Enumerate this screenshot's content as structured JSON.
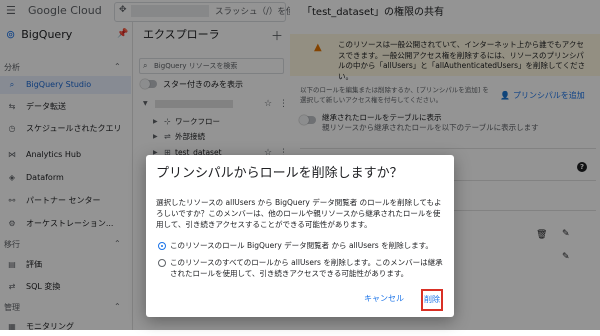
{
  "topbar": {
    "logo": "Google Cloud",
    "project_selector_text": "スラッシュ（/）を使用"
  },
  "sidebar": {
    "product": "BigQuery",
    "sections": [
      {
        "label": "分析"
      },
      {
        "label": "移行"
      },
      {
        "label": "管理"
      }
    ],
    "items": [
      {
        "label": "BigQuery Studio",
        "icon": "search-icon"
      },
      {
        "label": "データ転送",
        "icon": "transfer-icon"
      },
      {
        "label": "スケジュールされたクエリ",
        "icon": "clock-icon"
      },
      {
        "label": "Analytics Hub",
        "icon": "hub-icon"
      },
      {
        "label": "Dataform",
        "icon": "dataform-icon"
      },
      {
        "label": "パートナー センター",
        "icon": "partner-icon"
      },
      {
        "label": "オーケストレーション...",
        "icon": "orchestration-icon"
      },
      {
        "label": "評価",
        "icon": "assessment-icon"
      },
      {
        "label": "SQL 変換",
        "icon": "translate-icon"
      },
      {
        "label": "モニタリング",
        "icon": "monitoring-icon"
      }
    ]
  },
  "explorer": {
    "title": "エクスプローラ",
    "search_placeholder": "BigQuery リソースを検索",
    "starred_only_label": "スター付きのみを表示",
    "tree": [
      {
        "label": "ワークフロー"
      },
      {
        "label": "外部接続"
      },
      {
        "label": "test_dataset"
      }
    ]
  },
  "panel": {
    "title": "「test_dataset」の権限の共有",
    "warning_text": "このリソースは一般公開されていて、インターネット上から誰でもアクセスできます。一般公開アクセス権を削除するには、リソースのプリンシパルの中から「allUsers」と「allAuthenticatedUsers」を削除してください。",
    "info_text": "以下のロールを編集または削除するか、[プリンシパルを追加] を選択して新しいアクセス権を付与してください。",
    "add_principal_label": "プリンシパルを追加",
    "inherited_roles_label": "継承されたロールをテーブルに表示",
    "inherited_roles_desc": "親リソースから継承されたロールを以下のテーブルに表示します"
  },
  "dialog": {
    "title": "プリンシパルからロールを削除しますか？",
    "description": "選択したリソースの allUsers から BigQuery データ閲覧者 のロールを削除してもよろしいですか？このメンバーは、他のロールや親リソースから継承されたロールを使用して、引き続きアクセスすることができる可能性があります。",
    "option1": "このリソースのロール BigQuery データ閲覧者 から allUsers を削除します。",
    "option2": "このリソースのすべてのロールから allUsers を削除します。このメンバーは継承されたロールを使用して、引き続きアクセスできる可能性があります。",
    "selected_option": 1,
    "cancel_label": "キャンセル",
    "delete_label": "削除"
  },
  "colors": {
    "accent": "#1a73e8",
    "warning_bg": "#fef7e0",
    "warning_icon": "#e37400",
    "highlight_border": "#d93025",
    "overlay": "rgba(0,0,0,0.42)"
  }
}
